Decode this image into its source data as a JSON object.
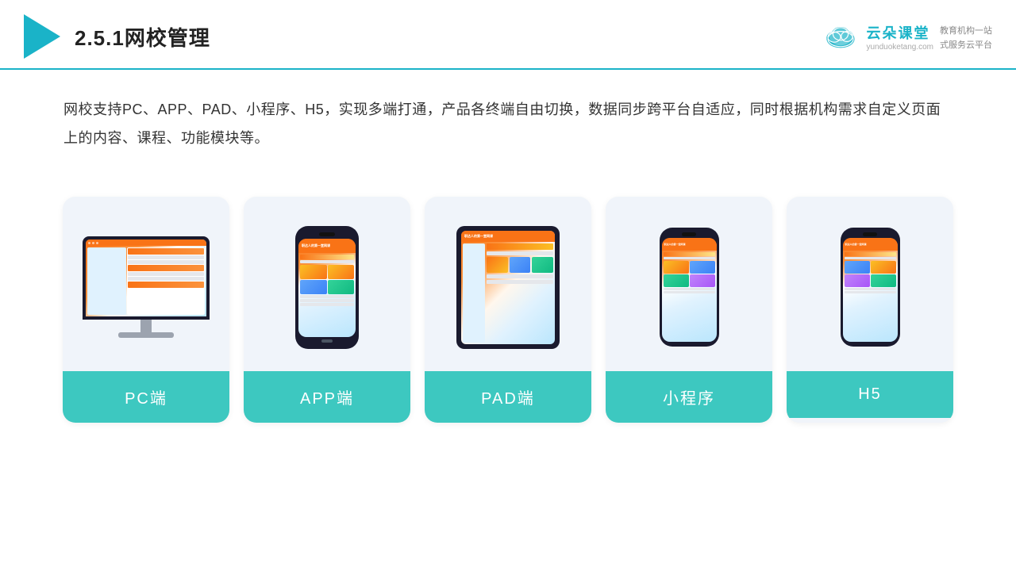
{
  "header": {
    "title": "2.5.1网校管理",
    "brand_name": "云朵课堂",
    "brand_url": "yunduoketang.com",
    "brand_tagline": "教育机构一站",
    "brand_tagline2": "式服务云平台"
  },
  "description": {
    "text": "网校支持PC、APP、PAD、小程序、H5，实现多端打通，产品各终端自由切换，数据同步跨平台自适应，同时根据机构需求自定义页面上的内容、课程、功能模块等。"
  },
  "cards": [
    {
      "id": "pc",
      "label": "PC端"
    },
    {
      "id": "app",
      "label": "APP端"
    },
    {
      "id": "pad",
      "label": "PAD端"
    },
    {
      "id": "miniprogram",
      "label": "小程序"
    },
    {
      "id": "h5",
      "label": "H5"
    }
  ]
}
